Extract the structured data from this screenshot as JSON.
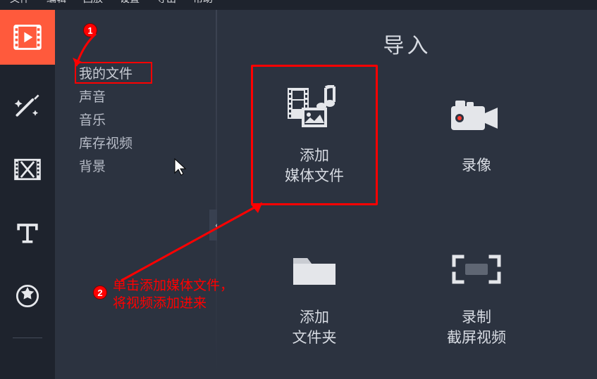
{
  "menubar": {
    "items": [
      "文件",
      "编辑",
      "回放",
      "设置",
      "导出",
      "帮助"
    ]
  },
  "sidebar_tools": [
    {
      "id": "import",
      "active": true
    },
    {
      "id": "filters",
      "active": false
    },
    {
      "id": "transitions",
      "active": false
    },
    {
      "id": "titles",
      "active": false
    },
    {
      "id": "stickers",
      "active": false
    }
  ],
  "categories": {
    "items": [
      {
        "label": "我的文件",
        "selected": true,
        "highlight": true
      },
      {
        "label": "声音",
        "selected": false
      },
      {
        "label": "音乐",
        "selected": false
      },
      {
        "label": "库存视频",
        "selected": false
      },
      {
        "label": "背景",
        "selected": false
      }
    ]
  },
  "main": {
    "heading": "导入",
    "tiles": [
      {
        "id": "add-media",
        "label": "添加\n媒体文件",
        "highlight": true
      },
      {
        "id": "record-video",
        "label": "录像"
      },
      {
        "id": "add-folder",
        "label": "添加\n文件夹"
      },
      {
        "id": "record-screen",
        "label": "录制\n截屏视频"
      }
    ]
  },
  "annotations": {
    "badge1": "1",
    "badge2": "2",
    "text2": "单击添加媒体文件，\n将视频添加进来"
  },
  "collapse_glyph": "‹"
}
